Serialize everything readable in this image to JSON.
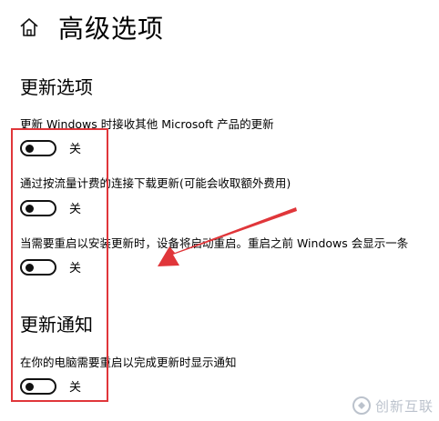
{
  "header": {
    "title": "高级选项",
    "home_icon": "home-icon"
  },
  "update_options": {
    "title": "更新选项",
    "items": [
      {
        "label": "更新 Windows 时接收其他 Microsoft 产品的更新",
        "state": "关"
      },
      {
        "label": "通过按流量计费的连接下载更新(可能会收取额外费用)",
        "state": "关"
      },
      {
        "label": "当需要重启以安装更新时，设备将启动重启。重启之前 Windows 会显示一条",
        "state": "关"
      }
    ]
  },
  "update_notifications": {
    "title": "更新通知",
    "items": [
      {
        "label": "在你的电脑需要重启以完成更新时显示通知",
        "state": "关"
      }
    ]
  },
  "annotations": {
    "highlight_color": "#e0363a",
    "arrow_color": "#e0363a"
  },
  "watermark": {
    "text": "创新互联"
  }
}
